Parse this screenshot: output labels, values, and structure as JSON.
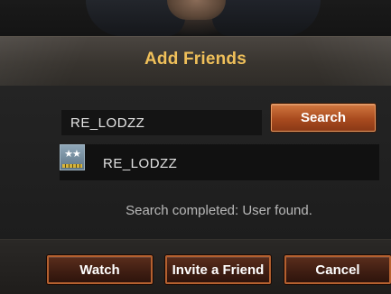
{
  "dialog": {
    "title": "Add Friends"
  },
  "search": {
    "input_value": "RE_LODZZ",
    "button_label": "Search"
  },
  "result": {
    "player_name": "RE_LODZZ",
    "badge_icon": "rank-badge-icon",
    "status_text": "Search completed: User found."
  },
  "footer": {
    "watch_label": "Watch",
    "invite_label": "Invite a Friend",
    "cancel_label": "Cancel"
  },
  "colors": {
    "title": "#f0c05a",
    "accent_button": "#c26a35",
    "button_border": "#b4602f"
  }
}
